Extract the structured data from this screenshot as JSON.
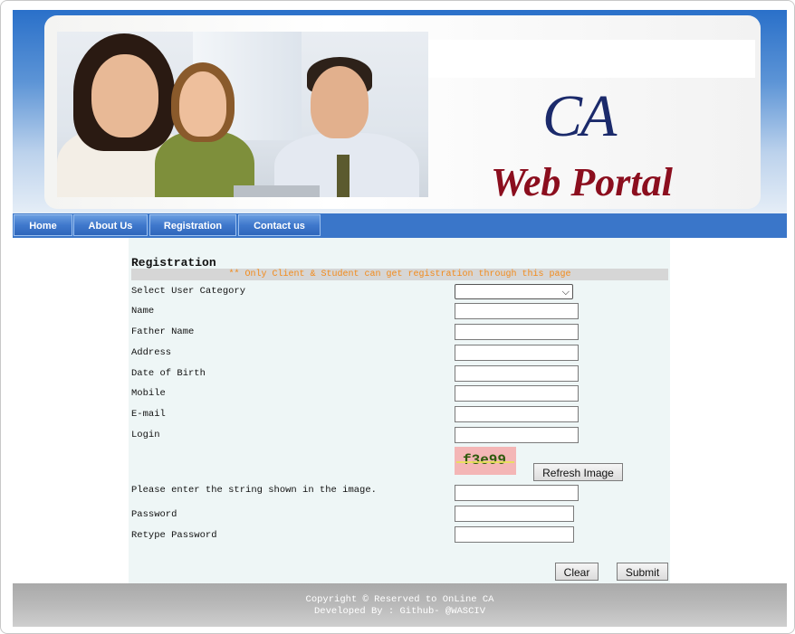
{
  "header": {
    "logo_ca": "CA",
    "logo_sub": "Web Portal"
  },
  "nav": {
    "items": [
      {
        "label": "Home"
      },
      {
        "label": "About Us"
      },
      {
        "label": "Registration"
      },
      {
        "label": "Contact us"
      }
    ]
  },
  "form": {
    "title": "Registration",
    "notice": "** Only Client & Student can get registration through this page",
    "fields": {
      "category": {
        "label": "Select User Category",
        "value": ""
      },
      "name": {
        "label": "Name",
        "value": ""
      },
      "father_name": {
        "label": "Father Name",
        "value": ""
      },
      "address": {
        "label": "Address",
        "value": ""
      },
      "dob": {
        "label": "Date of Birth",
        "value": ""
      },
      "mobile": {
        "label": "Mobile",
        "value": ""
      },
      "email": {
        "label": "E-mail",
        "value": ""
      },
      "login": {
        "label": "Login",
        "value": ""
      },
      "captcha_input": {
        "label": "Please enter the string shown in the image.",
        "value": ""
      },
      "password": {
        "label": "Password",
        "value": ""
      },
      "retype_password": {
        "label": "Retype Password",
        "value": ""
      }
    },
    "captcha_text": "f3e99",
    "refresh_label": "Refresh Image",
    "clear_label": "Clear",
    "submit_label": "Submit"
  },
  "footer": {
    "copyright": "Copyright © Reserved to OnLine CA",
    "developer": "Developed By : Github- @WASCIV"
  },
  "colors": {
    "nav_blue": "#3a76c9",
    "notice_orange": "#f28a1a",
    "form_bg": "#eef6f6",
    "logo_navy": "#1b2a6b",
    "logo_maroon": "#8b0e1e"
  }
}
